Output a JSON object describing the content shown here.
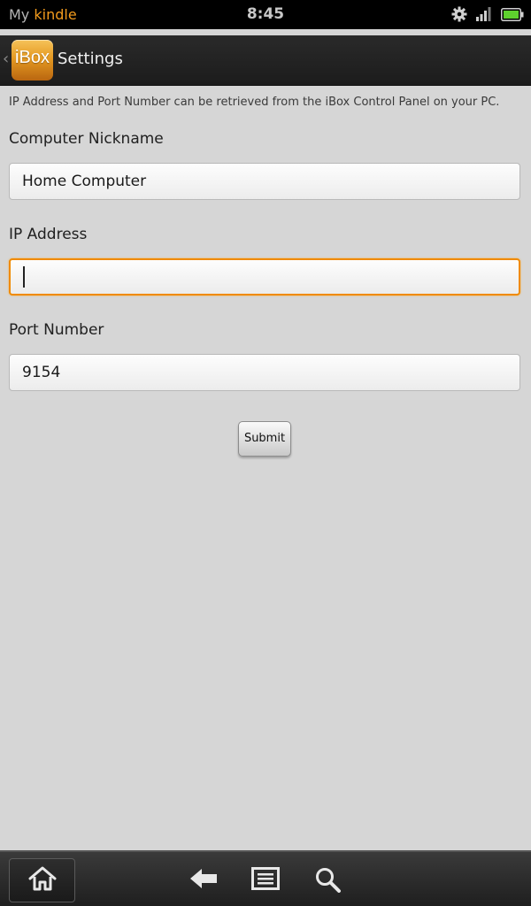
{
  "status_bar": {
    "brand_prefix": "My",
    "brand_name": "kindle",
    "time": "8:45",
    "icons": [
      "gear-icon",
      "signal-icon",
      "battery-icon"
    ]
  },
  "action_bar": {
    "app_logo_text": "iBox",
    "title": "Settings"
  },
  "form": {
    "hint": "IP Address and Port Number can be retrieved from the iBox Control Panel on your PC.",
    "nickname": {
      "label": "Computer Nickname",
      "value": "Home Computer"
    },
    "ip_address": {
      "label": "IP Address",
      "value": ""
    },
    "port": {
      "label": "Port Number",
      "value": "9154"
    },
    "submit_label": "Submit"
  },
  "nav_bar": {
    "icons": [
      "home-icon",
      "back-arrow-icon",
      "menu-icon",
      "search-icon"
    ]
  },
  "colors": {
    "accent": "#f29b1d",
    "focus_border": "#f08a00",
    "background": "#d6d6d6"
  }
}
